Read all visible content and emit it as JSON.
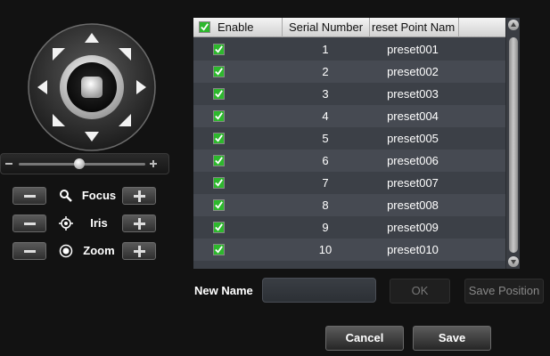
{
  "lens": {
    "focus_label": "Focus",
    "iris_label": "Iris",
    "zoom_label": "Zoom"
  },
  "speed": {
    "level": 0.48
  },
  "table": {
    "headers": {
      "enable": "Enable",
      "serial": "Serial Number",
      "name": "reset Point Nam"
    },
    "header_checked": true,
    "rows": [
      {
        "serial": "1",
        "name": "preset001",
        "enabled": true
      },
      {
        "serial": "2",
        "name": "preset002",
        "enabled": true
      },
      {
        "serial": "3",
        "name": "preset003",
        "enabled": true
      },
      {
        "serial": "4",
        "name": "preset004",
        "enabled": true
      },
      {
        "serial": "5",
        "name": "preset005",
        "enabled": true
      },
      {
        "serial": "6",
        "name": "preset006",
        "enabled": true
      },
      {
        "serial": "7",
        "name": "preset007",
        "enabled": true
      },
      {
        "serial": "8",
        "name": "preset008",
        "enabled": true
      },
      {
        "serial": "9",
        "name": "preset009",
        "enabled": true
      },
      {
        "serial": "10",
        "name": "preset010",
        "enabled": true
      }
    ]
  },
  "form": {
    "new_name_label": "New Name",
    "new_name_value": "",
    "ok_label": "OK",
    "save_position_label": "Save Position"
  },
  "footer": {
    "cancel_label": "Cancel",
    "save_label": "Save"
  },
  "colors": {
    "check_green": "#2db82d",
    "table_bg": "#3c4047",
    "page_bg": "#121212"
  },
  "icons": {
    "focus": "magnifier-icon",
    "iris": "iris-crosshair-icon",
    "zoom": "zoom-circle-icon"
  }
}
